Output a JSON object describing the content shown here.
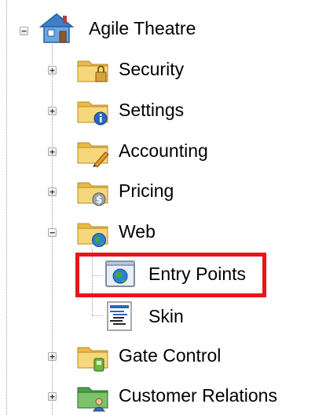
{
  "tree": {
    "root": {
      "label": "Agile Theatre",
      "expanded": true,
      "icon": "house-icon"
    },
    "items": [
      {
        "label": "Security",
        "expanded": false,
        "icon": "folder-lock-icon"
      },
      {
        "label": "Settings",
        "expanded": false,
        "icon": "folder-info-icon"
      },
      {
        "label": "Accounting",
        "expanded": false,
        "icon": "folder-pen-icon"
      },
      {
        "label": "Pricing",
        "expanded": false,
        "icon": "folder-dollar-icon"
      },
      {
        "label": "Web",
        "expanded": true,
        "icon": "folder-globe-icon",
        "children": [
          {
            "label": "Entry Points",
            "icon": "globe-window-icon",
            "highlighted": true
          },
          {
            "label": "Skin",
            "icon": "skin-document-icon"
          }
        ]
      },
      {
        "label": "Gate Control",
        "expanded": false,
        "icon": "folder-device-icon"
      },
      {
        "label": "Customer Relations",
        "expanded": false,
        "icon": "folder-people-icon"
      }
    ],
    "expander_collapsed": "+",
    "expander_expanded": "−"
  },
  "colors": {
    "folder": "#f2cf6a",
    "highlight": "#e8141c",
    "guide": "#a0a0a0"
  }
}
